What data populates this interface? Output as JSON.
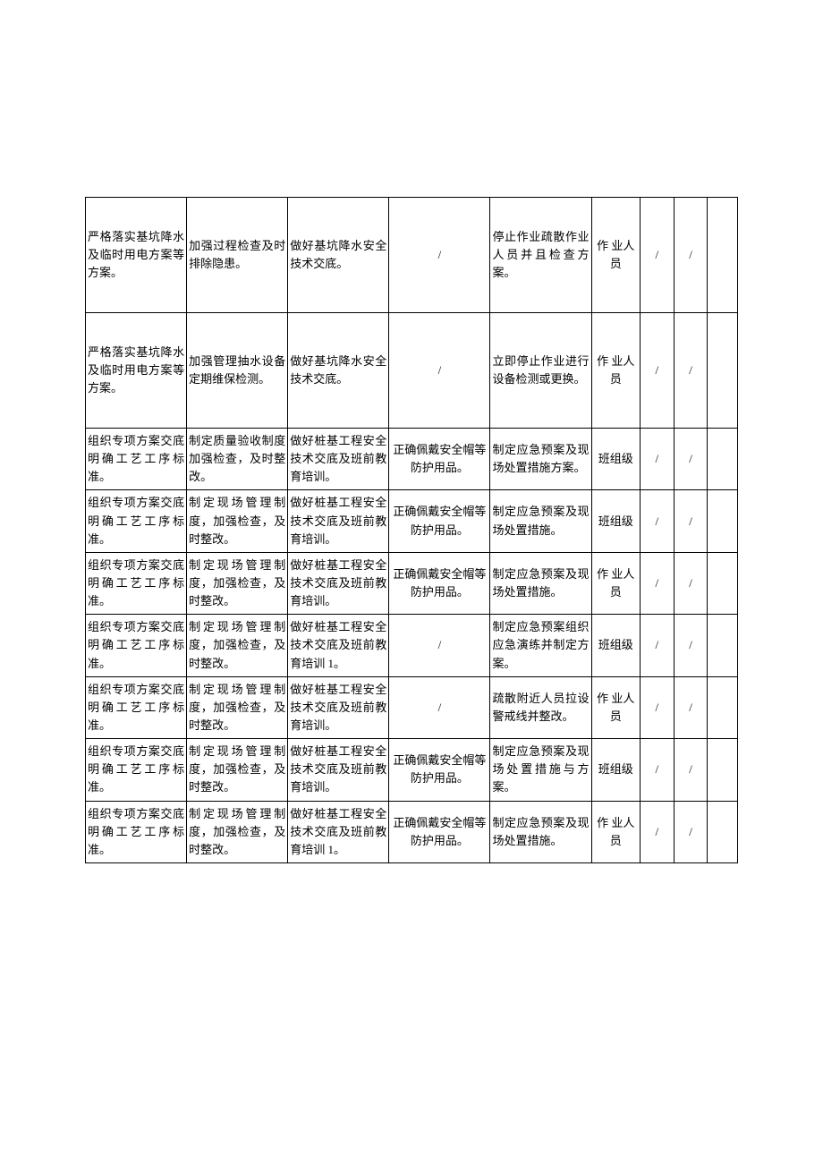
{
  "slash": "/",
  "rows": [
    {
      "c1": "严格落实基坑降水及临时用电方案等方案。",
      "c2": "加强过程检查及时排除隐患。",
      "c3": "做好基坑降水安全技术交底。",
      "c4": "/",
      "c5": "停止作业疏散作业人员并且检查方案。",
      "c6": "作 业人员",
      "c7": "/",
      "c8": "/",
      "c9": "",
      "tall": true
    },
    {
      "c1": "严格落实基坑降水及临时用电方案等方案。",
      "c2": "加强管理抽水设备定期维保检测。",
      "c3": "做好基坑降水安全技术交底。",
      "c4": "/",
      "c5": "立即停止作业进行设备检测或更换。",
      "c6": "作 业人员",
      "c7": "/",
      "c8": "/",
      "c9": "",
      "tall": true
    },
    {
      "c1": "组织专项方案交底明确工艺工序标准。",
      "c2": "制定质量验收制度加强检查，及时整改。",
      "c3": "做好桩基工程安全技术交底及班前教育培训。",
      "c4": "正确佩戴安全帽等防护用品。",
      "c5": "制定应急预案及现场处置措施方案。",
      "c6": "班组级",
      "c7": "/",
      "c8": "/",
      "c9": ""
    },
    {
      "c1": "组织专项方案交底明确工艺工序标准。",
      "c2": "制定现场管理制度，加强检查，及时整改。",
      "c3": "做好桩基工程安全技术交底及班前教育培训。",
      "c4": "正确佩戴安全帽等防护用品。",
      "c5": "制定应急预案及现场处置措施。",
      "c6": "班组级",
      "c7": "/",
      "c8": "/",
      "c9": ""
    },
    {
      "c1": "组织专项方案交底明确工艺工序标准。",
      "c2": "制定现场管理制度，加强检查，及时整改。",
      "c3": "做好桩基工程安全技术交底及班前教育培训。",
      "c4": "正确佩戴安全帽等防护用品。",
      "c5": "制定应急预案及现场处置措施。",
      "c6": "作 业人员",
      "c7": "/",
      "c8": "/",
      "c9": ""
    },
    {
      "c1": "组织专项方案交底明确工艺工序标准。",
      "c2": "制定现场管理制度，加强检查，及时整改。",
      "c3": "做好桩基工程安全技术交底及班前教育培训 1。",
      "c4": "/",
      "c5": "制定应急预案组织应急演练并制定方案。",
      "c6": "班组级",
      "c7": "/",
      "c8": "/",
      "c9": ""
    },
    {
      "c1": "组织专项方案交底明确工艺工序标准。",
      "c2": "制定现场管理制度，加强检查，及时整改。",
      "c3": "做好桩基工程安全技术交底及班前教育培训。",
      "c4": "/",
      "c5": "疏散附近人员拉设警戒线并整改。",
      "c6": "作 业人员",
      "c7": "/",
      "c8": "/",
      "c9": ""
    },
    {
      "c1": "组织专项方案交底明确工艺工序标准。",
      "c2": "制定现场管理制度，加强检查，及时整改。",
      "c3": "做好桩基工程安全技术交底及班前教育培训。",
      "c4": "正确佩戴安全帽等防护用品。",
      "c5": "制定应急预案及现场处置措施与方案。",
      "c6": "班组级",
      "c7": "/",
      "c8": "/",
      "c9": ""
    },
    {
      "c1": "组织专项方案交底明确工艺工序标准。",
      "c2": "制定现场管理制度，加强检查，及时整改。",
      "c3": "做好桩基工程安全技术交底及班前教育培训 1。",
      "c4": "正确佩戴安全帽等防护用品。",
      "c5": "制定应急预案及现场处置措施。",
      "c6": "作 业人员",
      "c7": "/",
      "c8": "/",
      "c9": ""
    }
  ]
}
